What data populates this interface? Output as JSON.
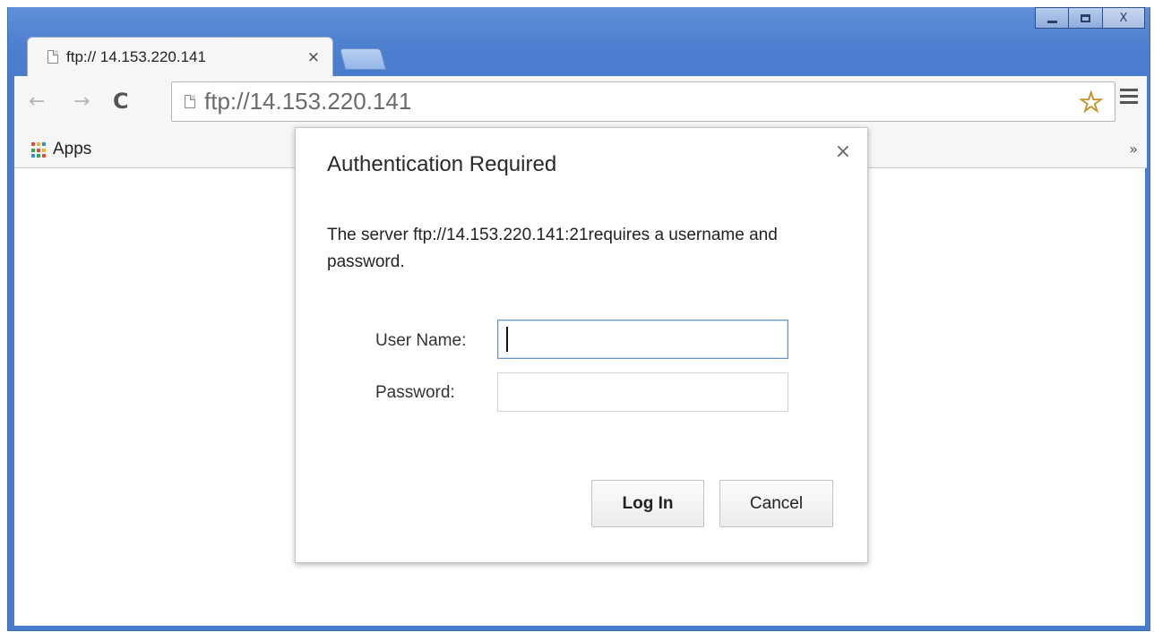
{
  "window": {
    "controls": {
      "minimize": "minimize-icon",
      "maximize": "maximize-icon",
      "close_label": "X"
    }
  },
  "tab": {
    "title": "ftp:// 14.153.220.141",
    "close_label": "×"
  },
  "toolbar": {
    "back_label": "←",
    "forward_label": "→",
    "reload_label": "C",
    "url": "ftp://14.153.220.141"
  },
  "bookmarks": {
    "apps_label": "Apps",
    "overflow_label": "»"
  },
  "dialog": {
    "title": "Authentication Required",
    "close_label": "×",
    "message": "The server ftp://14.153.220.141:21requires a username and password.",
    "username_label": "User Name:",
    "username_value": "",
    "password_label": "Password:",
    "password_value": "",
    "login_label": "Log In",
    "cancel_label": "Cancel"
  },
  "colors": {
    "frame": "#4a7ccd",
    "dialog_bg": "#ffffff",
    "toolbar_bg": "#f6f6f6",
    "star": "#f3c23b"
  }
}
